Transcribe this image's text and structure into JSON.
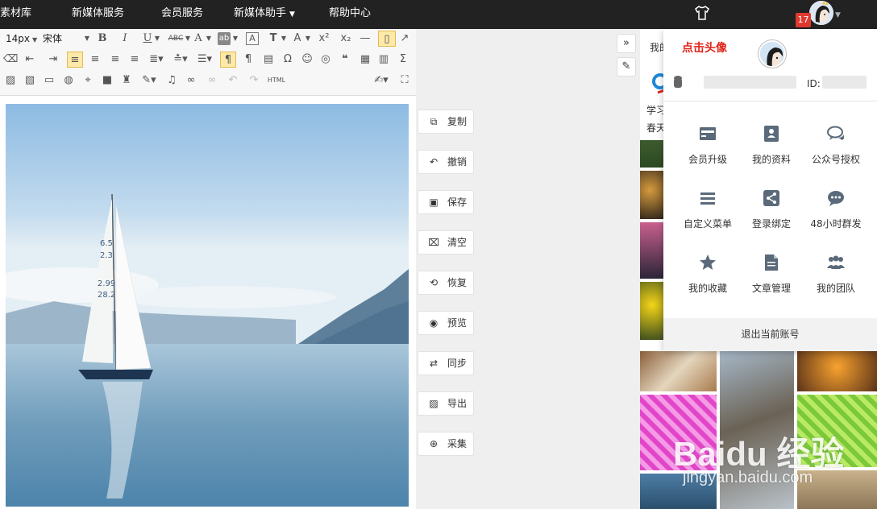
{
  "nav": {
    "items": [
      {
        "label": "素材库"
      },
      {
        "label": "新媒体服务"
      },
      {
        "label": "会员服务"
      },
      {
        "label": "新媒体助手"
      },
      {
        "label": "帮助中心"
      }
    ],
    "badge_count": "17"
  },
  "toolbar": {
    "font_size": "14px",
    "font_family": "宋体",
    "html_label": "HTML",
    "icons_row1": [
      "B",
      "I",
      "U",
      "ABC",
      "A",
      "ab",
      "A",
      "T",
      "A",
      "x²",
      "x₂"
    ],
    "icons_row3_symbol": "Ω"
  },
  "side_buttons": [
    {
      "label": "复制",
      "icon": "copy-icon"
    },
    {
      "label": "撤销",
      "icon": "undo-icon"
    },
    {
      "label": "保存",
      "icon": "save-icon"
    },
    {
      "label": "清空",
      "icon": "trash-icon"
    },
    {
      "label": "恢复",
      "icon": "restore-icon"
    },
    {
      "label": "预览",
      "icon": "eye-icon"
    },
    {
      "label": "同步",
      "icon": "sync-icon"
    },
    {
      "label": "导出",
      "icon": "export-icon"
    },
    {
      "label": "采集",
      "icon": "collect-icon"
    }
  ],
  "right_pane": {
    "title_fragment": "我的",
    "text_line1": "学习",
    "text_line2": "春天"
  },
  "dropdown": {
    "id_label": "ID:",
    "items": [
      {
        "label": "会员升级",
        "icon": "card-icon"
      },
      {
        "label": "我的资料",
        "icon": "contact-card-icon"
      },
      {
        "label": "公众号授权",
        "icon": "chat-bubbles-icon"
      },
      {
        "label": "自定义菜单",
        "icon": "menu-bars-icon"
      },
      {
        "label": "登录绑定",
        "icon": "share-icon"
      },
      {
        "label": "48小时群发",
        "icon": "comment-dots-icon"
      },
      {
        "label": "我的收藏",
        "icon": "star-icon"
      },
      {
        "label": "文章管理",
        "icon": "document-icon"
      },
      {
        "label": "我的团队",
        "icon": "team-icon"
      }
    ],
    "logout_label": "退出当前账号"
  },
  "annotation": {
    "text": "点击头像",
    "color": "#e0231b"
  },
  "watermark": {
    "line1": "Baidu 经验",
    "line2": "jingyan.baidu.com"
  },
  "colors": {
    "topbar": "#222222",
    "badge": "#e03a2f",
    "active_tool": "#fde9a8",
    "icon_gray": "#5a6a7a"
  }
}
